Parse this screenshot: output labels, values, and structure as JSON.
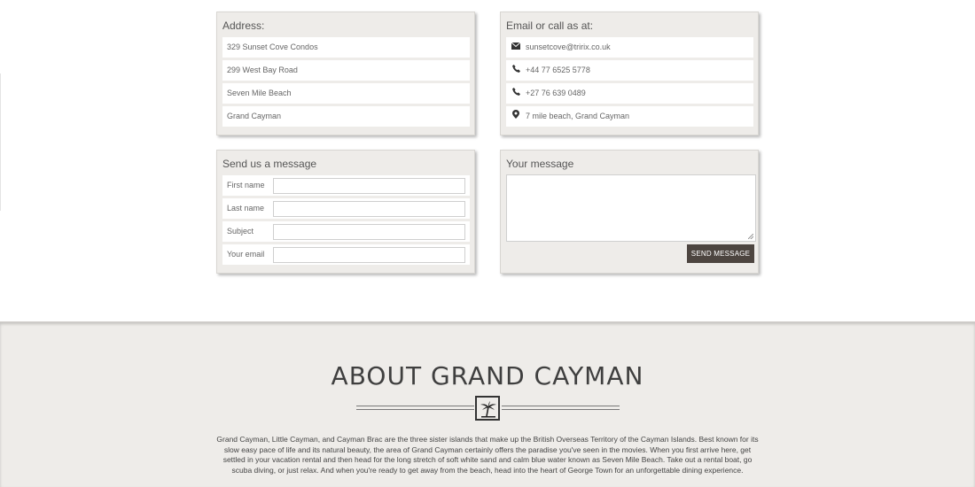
{
  "address": {
    "title": "Address:",
    "lines": [
      "329 Sunset Cove Condos",
      "299 West Bay Road",
      "Seven Mile Beach",
      "Grand Cayman"
    ]
  },
  "contact": {
    "title": "Email or call as at:",
    "items": [
      {
        "icon": "envelope-icon",
        "text": "sunsetcove@tririx.co.uk"
      },
      {
        "icon": "phone-icon",
        "text": "+44 77 6525 5778"
      },
      {
        "icon": "phone-icon",
        "text": "+27 76 639 0489"
      },
      {
        "icon": "map-pin-icon",
        "text": "7 mile beach, Grand Cayman"
      }
    ]
  },
  "send_form": {
    "title": "Send us a message",
    "fields": [
      {
        "label": "First name",
        "value": ""
      },
      {
        "label": "Last name",
        "value": ""
      },
      {
        "label": "Subject",
        "value": ""
      },
      {
        "label": "Your email",
        "value": ""
      }
    ]
  },
  "message": {
    "title": "Your message",
    "value": "",
    "button_label": "SEND MESSAGE"
  },
  "about": {
    "title": "ABOUT GRAND CAYMAN",
    "icon": "palm-tree-icon",
    "text": "Grand Cayman, Little Cayman, and Cayman Brac are the three sister islands that make up the British Overseas Territory of the Cayman Islands. Best known for its slow easy pace of life and its natural beauty, the area of Grand Cayman certainly offers the paradise you've seen in the movies. When you first arrive here, get settled in your vacation rental and then head for the long stretch of soft white sand and calm blue water known as Seven Mile Beach. Take out a rental boat, go scuba diving, or just relax. And when you're ready to get away from the beach, head into the heart of George Town for an unforgettable dining experience."
  },
  "colors": {
    "panel_bg": "#eeece9",
    "button_bg": "#4d4540",
    "heading_text": "#3f3f3f"
  }
}
